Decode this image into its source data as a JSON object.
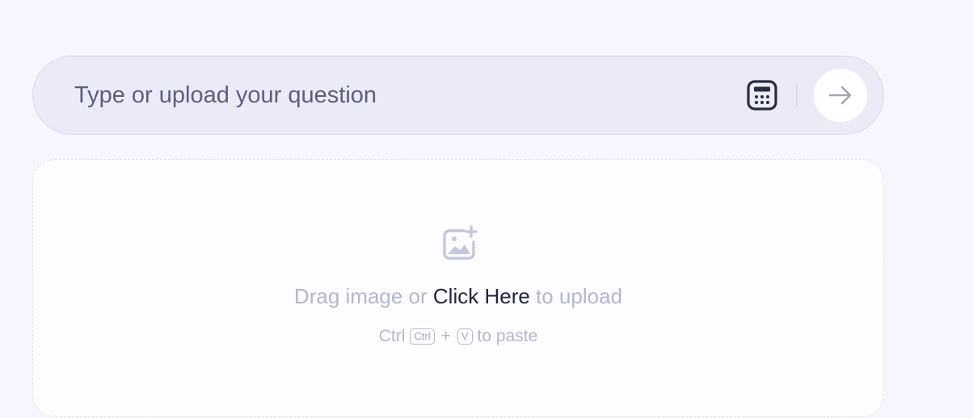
{
  "question": {
    "placeholder": "Type or upload your question",
    "value": "",
    "calculator_icon": "calculator-icon",
    "send_icon": "arrow-right-icon"
  },
  "upload": {
    "icon": "image-add-icon",
    "drag_text_before": "Drag image or",
    "click_link": "Click Here",
    "drag_text_after": "to upload",
    "paste": {
      "prefix": "Ctrl",
      "key_ctrl": "Ctrl",
      "plus": "+",
      "key_v": "V",
      "suffix": "to paste"
    }
  },
  "colors": {
    "background": "#f6f6fe",
    "input_bar": "#ebebf8",
    "upload_zone": "#fdfdff",
    "link_text": "#23243f",
    "muted_text": "#b4b6cc"
  }
}
